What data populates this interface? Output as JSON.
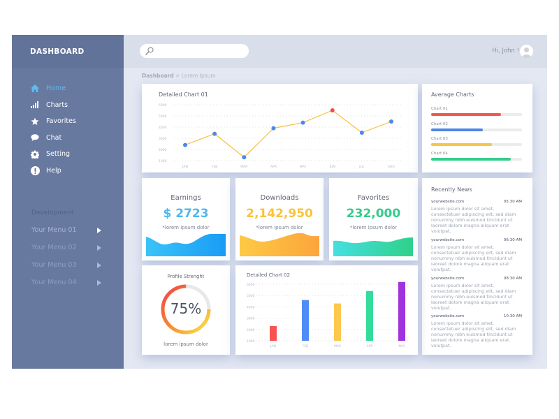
{
  "sidebar": {
    "title": "DASHBOARD",
    "nav": [
      {
        "label": "Home",
        "icon": "home-icon",
        "active": true
      },
      {
        "label": "Charts",
        "icon": "bar-chart-icon",
        "active": false
      },
      {
        "label": "Favorites",
        "icon": "star-icon",
        "active": false
      },
      {
        "label": "Chat",
        "icon": "chat-bubble-icon",
        "active": false
      },
      {
        "label": "Setting",
        "icon": "gear-icon",
        "active": false
      },
      {
        "label": "Help",
        "icon": "exclamation-icon",
        "active": false
      }
    ],
    "section_label": "Development",
    "menus": [
      {
        "label": "Your Menu 01"
      },
      {
        "label": "Your Menu 02"
      },
      {
        "label": "Your Menu 03"
      },
      {
        "label": "Your Menu 04"
      }
    ]
  },
  "topbar": {
    "search_placeholder": "",
    "search_value": "",
    "greeting": "Hi, John !"
  },
  "breadcrumb": {
    "root": "Dashboard",
    "separator": ">",
    "current": "Lorem Ipsum"
  },
  "colors": {
    "sidebar": "#6879a0",
    "accent": "#5bbcf4",
    "red": "#f0584f",
    "blue": "#4f8df0",
    "yellow": "#fbc645",
    "green": "#34d39a",
    "purple": "#a234dc"
  },
  "chart1": {
    "title": "Detailed Chart 01"
  },
  "average": {
    "title": "Average Charts",
    "items": [
      {
        "label": "Chart 01",
        "percent": 77,
        "color": "#ee5a50"
      },
      {
        "label": "Chart 02",
        "percent": 57,
        "color": "#4f85e4"
      },
      {
        "label": "Chart 03",
        "percent": 67,
        "color": "#f6c549"
      },
      {
        "label": "Chart 04",
        "percent": 88,
        "color": "#33cd8c"
      }
    ]
  },
  "kpis": [
    {
      "title": "Earnings",
      "value": "$ 2723",
      "sub": "*lorem ipsum dolor",
      "color": "#4fb6f0"
    },
    {
      "title": "Downloads",
      "value": "2,142,950",
      "sub": "*lorem ipsum dolor",
      "color": "#f9c33c"
    },
    {
      "title": "Favorites",
      "value": "232,000",
      "sub": "*lorem ipsum dolor",
      "color": "#32cc8d"
    }
  ],
  "news": {
    "title": "Recently News",
    "items": [
      {
        "source": "yourwebsite.com",
        "time": "05:30 AM",
        "body": "Lorem ipsum dolor sit amet, consectetuer adipiscing elit, sed diam nonummy nibh euismod tincidunt ut laoreet dolore magna aliquam erat volutpat."
      },
      {
        "source": "yourwebsite.com",
        "time": "06:30 AM",
        "body": "Lorem ipsum dolor sit amet, consectetuer adipiscing elit, sed diam nonummy nibh euismod tincidunt ut laoreet dolore magna aliquam erat volutpat."
      },
      {
        "source": "yourwebsite.com",
        "time": "08:30 AM",
        "body": "Lorem ipsum dolor sit amet, consectetuer adipiscing elit, sed diam nonummy nibh euismod tincidunt ut laoreet dolore magna aliquam erat volutpat."
      },
      {
        "source": "yourwebsite.com",
        "time": "10:30 AM",
        "body": "Lorem ipsum dolor sit amet, consectetuer adipiscing elit, sed diam nonummy nibh euismod tincidunt ut laoreet dolore magna aliquam erat volutpat."
      }
    ]
  },
  "profile": {
    "title": "Profile Strenght",
    "value": "75%",
    "percent": 75,
    "sub": "lorem ipsum dolor"
  },
  "chart2": {
    "title": "Detailed Chart 02"
  },
  "chart_data": [
    {
      "type": "line",
      "title": "Detailed Chart 01",
      "categories": [
        "JAN",
        "FEB",
        "MAR",
        "APR",
        "MAY",
        "JUN",
        "JUL",
        "AUG"
      ],
      "values": [
        2400,
        3400,
        1300,
        3900,
        4400,
        5500,
        3500,
        4500
      ],
      "highlight_index": 5,
      "line_color": "#f7c03d",
      "point_color": "#4f86ec",
      "highlight_color": "#ef4d47",
      "yticks": [
        1000,
        2000,
        3000,
        4000,
        5000,
        6000
      ],
      "ylim": [
        1000,
        6000
      ],
      "xlabel": "",
      "ylabel": "",
      "grid": true
    },
    {
      "type": "bar",
      "title": "Detailed Chart 02",
      "categories": [
        "JAN",
        "FEB",
        "MAR",
        "APR",
        "MAY"
      ],
      "values": [
        2300,
        4600,
        4300,
        5400,
        6200
      ],
      "colors": [
        "#f75451",
        "#4f8df5",
        "#fdc84f",
        "#33dc9b",
        "#a232de"
      ],
      "yticks": [
        1000,
        2000,
        3000,
        4000,
        5000,
        6000
      ],
      "ylim": [
        1000,
        6000
      ],
      "xlabel": "",
      "ylabel": "",
      "grid": true
    }
  ]
}
